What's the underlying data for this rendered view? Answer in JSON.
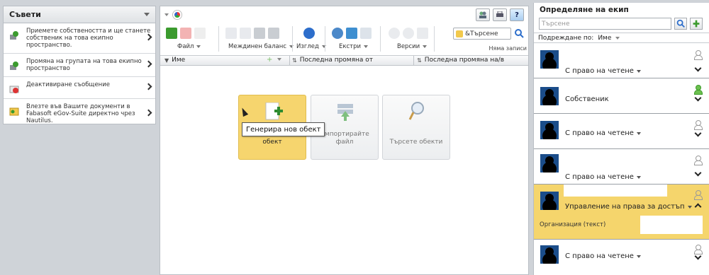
{
  "tips": {
    "title": "Съвети",
    "items": [
      {
        "text": "Приемете собствеността и ще станете собственик на това екипно пространство."
      },
      {
        "text": "Промяна на групата на това екипно пространство"
      },
      {
        "text": "Деактивиране съобщение"
      },
      {
        "text": "Влезте във Вашите документи в Fabasoft eGov-Suite директно чрез Nautilus."
      }
    ]
  },
  "toolbar": {
    "file_label": "Файл",
    "balance_label": "Междинен баланс",
    "view_label": "Изглед",
    "extras_label": "Екстри",
    "versions_label": "Версии",
    "search_value": "&Търсене",
    "no_more": "Няма записи"
  },
  "columns": {
    "name": "Име",
    "last_changed_by": "Последна промяна от",
    "last_changed_at": "Последна промяна на/в"
  },
  "tiles": {
    "create_line2": "обект",
    "import": "Импортирайте файл",
    "search": "Търсете обекти"
  },
  "tooltip": "Генерира нов обект",
  "team": {
    "title": "Определяне на екип",
    "search_placeholder": "Търсене",
    "sort_label": "Подреждане по:",
    "sort_value": "Име",
    "members": [
      {
        "role": "С право на четене"
      },
      {
        "role": "Собственик"
      },
      {
        "role": "С право на четене"
      },
      {
        "role": "С право на четене"
      },
      {
        "role": "Управление на права за достъп"
      },
      {
        "role": "С право на четене"
      }
    ],
    "org_label": "Организация (текст)"
  },
  "colors": {
    "accent": "#f5d56c",
    "panel_border": "#b9bec4"
  },
  "icons": [
    "key-icon",
    "group-icon",
    "deactivate-icon",
    "folder-icon",
    "search-icon",
    "print-icon",
    "help-icon",
    "plus-icon",
    "person-icon"
  ]
}
